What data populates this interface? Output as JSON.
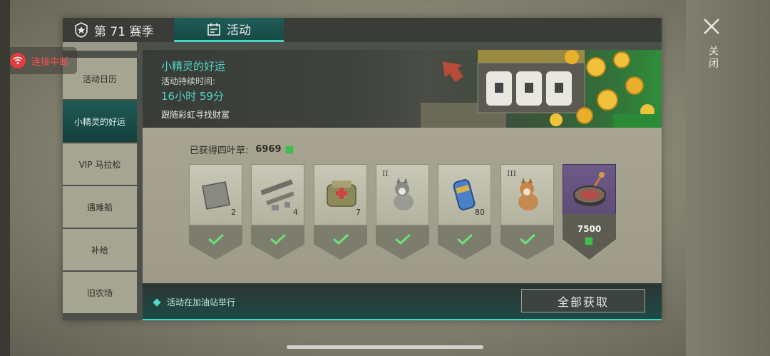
{
  "tabs": [
    {
      "label": "第 71 赛季",
      "icon": "shield-star-icon"
    },
    {
      "label": "活动",
      "icon": "calendar-icon"
    }
  ],
  "nav": {
    "items": [
      {
        "label": "活动日历"
      },
      {
        "label": "小精灵的好运"
      },
      {
        "label": "VIP 马拉松"
      },
      {
        "label": "遇难船"
      },
      {
        "label": "补给"
      },
      {
        "label": "旧农场"
      }
    ]
  },
  "status": {
    "disconnect_label": "连接中断"
  },
  "banner": {
    "title": "小精灵的好运",
    "duration_label": "活动持续时间:",
    "duration_value": "16小时 59分",
    "description": "跟随彩虹寻找财富"
  },
  "clovers": {
    "label": "已获得四叶草:",
    "count": "6969"
  },
  "rewards": [
    {
      "icon": "metal-plate-icon",
      "qty": "2",
      "roman": "",
      "claimed": true
    },
    {
      "icon": "weapon-parts-icon",
      "qty": "4",
      "roman": "",
      "claimed": true
    },
    {
      "icon": "medical-bag-icon",
      "qty": "7",
      "roman": "",
      "claimed": true
    },
    {
      "icon": "husky-puppy-icon",
      "qty": "",
      "roman": "II",
      "claimed": true
    },
    {
      "icon": "capsule-icon",
      "qty": "80",
      "roman": "",
      "claimed": true
    },
    {
      "icon": "shiba-puppy-icon",
      "qty": "",
      "roman": "III",
      "claimed": true
    },
    {
      "icon": "wheel-device-icon",
      "qty": "",
      "roman": "",
      "claimed": false,
      "price": "7500"
    }
  ],
  "footer": {
    "note": "活动在加油站举行",
    "claim_all": "全部获取"
  },
  "close": {
    "label": "关闭"
  },
  "colors": {
    "accent": "#4fd9c8",
    "alert": "#e23c3c",
    "clover": "#3fbf4a"
  }
}
